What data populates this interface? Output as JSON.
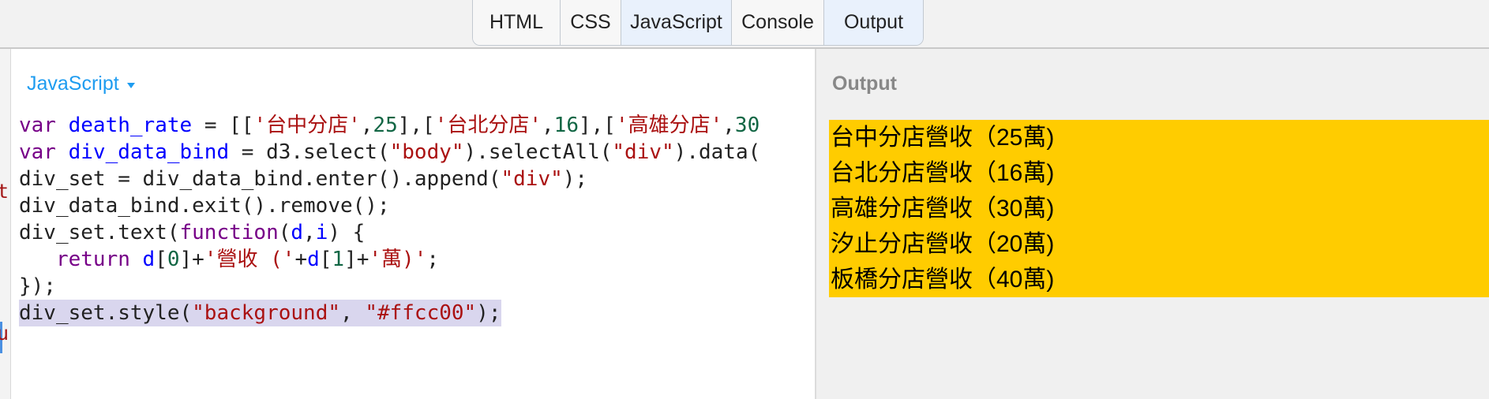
{
  "toolbar": {
    "tabs": [
      {
        "label": "HTML",
        "active": false
      },
      {
        "label": "CSS",
        "active": false
      },
      {
        "label": "JavaScript",
        "active": true
      },
      {
        "label": "Console",
        "active": false
      },
      {
        "label": "Output",
        "active": true
      }
    ]
  },
  "gutter": {
    "chars": [
      "t",
      "u"
    ]
  },
  "editor": {
    "language_label": "JavaScript",
    "dropdown_icon": "caret-down-icon",
    "lines": [
      [
        {
          "t": "var ",
          "c": "kw"
        },
        {
          "t": "death_rate",
          "c": "var"
        },
        {
          "t": " = [[",
          "c": "fn"
        },
        {
          "t": "'台中分店'",
          "c": "str"
        },
        {
          "t": ",",
          "c": "fn"
        },
        {
          "t": "25",
          "c": "num"
        },
        {
          "t": "],[",
          "c": "fn"
        },
        {
          "t": "'台北分店'",
          "c": "str"
        },
        {
          "t": ",",
          "c": "fn"
        },
        {
          "t": "16",
          "c": "num"
        },
        {
          "t": "],[",
          "c": "fn"
        },
        {
          "t": "'高雄分店'",
          "c": "str"
        },
        {
          "t": ",",
          "c": "fn"
        },
        {
          "t": "30",
          "c": "num"
        }
      ],
      [
        {
          "t": "var ",
          "c": "kw"
        },
        {
          "t": "div_data_bind",
          "c": "var"
        },
        {
          "t": " = d3.select(",
          "c": "fn"
        },
        {
          "t": "\"body\"",
          "c": "str"
        },
        {
          "t": ").selectAll(",
          "c": "fn"
        },
        {
          "t": "\"div\"",
          "c": "str"
        },
        {
          "t": ").data(",
          "c": "fn"
        }
      ],
      [
        {
          "t": "div_set = div_data_bind.enter().append(",
          "c": "fn"
        },
        {
          "t": "\"div\"",
          "c": "str"
        },
        {
          "t": ");",
          "c": "fn"
        }
      ],
      [
        {
          "t": "div_data_bind.exit().remove();",
          "c": "fn"
        }
      ],
      [
        {
          "t": "div_set.text(",
          "c": "fn"
        },
        {
          "t": "function",
          "c": "kw"
        },
        {
          "t": "(",
          "c": "fn"
        },
        {
          "t": "d",
          "c": "var"
        },
        {
          "t": ",",
          "c": "fn"
        },
        {
          "t": "i",
          "c": "var"
        },
        {
          "t": ") {",
          "c": "fn"
        }
      ],
      [
        {
          "t": "   ",
          "c": "fn"
        },
        {
          "t": "return ",
          "c": "kw"
        },
        {
          "t": "d",
          "c": "var"
        },
        {
          "t": "[",
          "c": "fn"
        },
        {
          "t": "0",
          "c": "num"
        },
        {
          "t": "]+",
          "c": "fn"
        },
        {
          "t": "'營收 ('",
          "c": "str"
        },
        {
          "t": "+",
          "c": "fn"
        },
        {
          "t": "d",
          "c": "var"
        },
        {
          "t": "[",
          "c": "fn"
        },
        {
          "t": "1",
          "c": "num"
        },
        {
          "t": "]+",
          "c": "fn"
        },
        {
          "t": "'萬)'",
          "c": "str"
        },
        {
          "t": ";",
          "c": "fn"
        }
      ],
      [
        {
          "t": "});",
          "c": "fn"
        }
      ],
      [
        {
          "t": "div_set.style(",
          "c": "fn"
        },
        {
          "t": "\"background\"",
          "c": "str"
        },
        {
          "t": ", ",
          "c": "fn"
        },
        {
          "t": "\"#ffcc00\"",
          "c": "str"
        },
        {
          "t": ");",
          "c": "fn"
        }
      ]
    ],
    "selected_line": 7
  },
  "output": {
    "title": "Output",
    "item_background": "#ffcc00",
    "items": [
      "台中分店營收（25萬)",
      "台北分店營收（16萬)",
      "高雄分店營收（30萬)",
      "汐止分店營收（20萬)",
      "板橋分店營收（40萬)"
    ]
  }
}
